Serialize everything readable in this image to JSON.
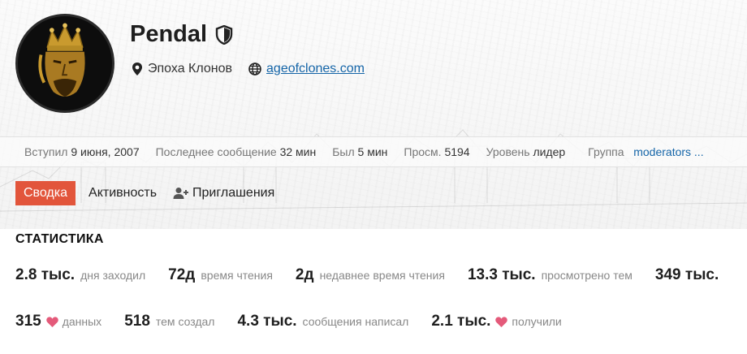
{
  "profile": {
    "username": "Pendal",
    "location": "Эпоха Клонов",
    "website": "ageofclones.com"
  },
  "stats_bar": {
    "joined_label": "Вступил",
    "joined_value": "9 июня, 2007",
    "last_post_label": "Последнее сообщение",
    "last_post_value": "32 мин",
    "seen_label": "Был",
    "seen_value": "5 мин",
    "views_label": "Просм.",
    "views_value": "5194",
    "level_label": "Уровень",
    "level_value": "лидер",
    "group_label": "Группа",
    "group_value": "moderators ..."
  },
  "tabs": [
    {
      "label": "Сводка"
    },
    {
      "label": "Активность"
    },
    {
      "label": "Приглашения"
    }
  ],
  "statistics": {
    "title": "СТАТИСТИКА",
    "row1": [
      {
        "value": "2.8 тыс.",
        "label": "дня заходил"
      },
      {
        "value": "72д",
        "label": "время чтения"
      },
      {
        "value": "2д",
        "label": "недавнее время чтения"
      },
      {
        "value": "13.3 тыс.",
        "label": "просмотрено тем"
      },
      {
        "value": "349 тыс.",
        "label": ""
      }
    ],
    "row2": [
      {
        "value": "315",
        "label": "данных"
      },
      {
        "value": "518",
        "label": "тем создал"
      },
      {
        "value": "4.3 тыс.",
        "label": "сообщения написал"
      },
      {
        "value": "2.1 тыс.",
        "label": "получили"
      }
    ]
  },
  "colors": {
    "accent": "#e2553b",
    "link": "#1565a8",
    "heart": "#e45a7a"
  },
  "icons": {
    "badge": "shield-icon",
    "location": "map-marker-icon",
    "website": "globe-icon",
    "invite": "user-plus-icon",
    "like": "heart-icon"
  }
}
